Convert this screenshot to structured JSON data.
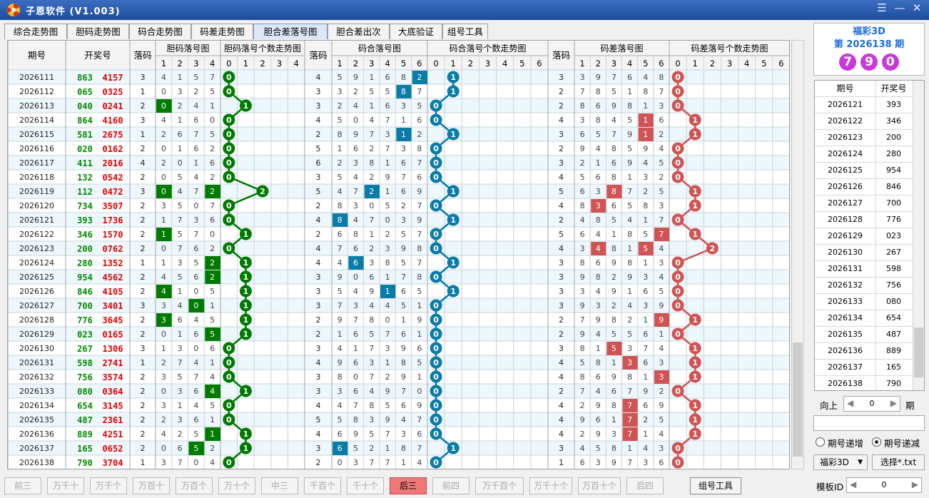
{
  "app": {
    "title": "子恩软件 (V1.003)",
    "minimize": "☰",
    "min": "—",
    "close": "✕"
  },
  "tabs": [
    "综合走势图",
    "胆码走势图",
    "码合走势图",
    "码差走势图",
    "胆合差落号图",
    "胆合差出次",
    "大底验证",
    "组号工具"
  ],
  "active_tab": 4,
  "grid": {
    "headers": {
      "period": "期号",
      "draw": "开奖号",
      "drop": "落码",
      "g1": "胆码落号图",
      "g2": "胆码落号个数走势图",
      "g3": "码合落号图",
      "g4": "码合落号个数走势图",
      "g5": "码差落号图",
      "g6": "码差落号个数走势图"
    },
    "sub_a": [
      "1",
      "2",
      "3",
      "4"
    ],
    "sub_b": [
      "0",
      "1",
      "2",
      "3",
      "4"
    ],
    "sub_c": [
      "1",
      "2",
      "3",
      "4",
      "5",
      "6"
    ],
    "sub_d": [
      "0",
      "1",
      "2",
      "3",
      "4",
      "5",
      "6"
    ],
    "colors": {
      "green": "#007a00",
      "blue": "#0a7ca8",
      "red": "#d05454",
      "row_alt": "#eef7fc",
      "green_text": "#008a00",
      "red_text": "#e00000"
    },
    "rows": [
      {
        "p": "2026111",
        "a": "863",
        "b": "4157",
        "d1": 3,
        "c1": [
          "4",
          "1",
          "5",
          "7"
        ],
        "h1": null,
        "n1": 0,
        "d2": 4,
        "c2": [
          "5",
          "9",
          "1",
          "6",
          "8",
          "2"
        ],
        "h2": 5,
        "n2": 1,
        "d3": 3,
        "c3": [
          "3",
          "9",
          "7",
          "6",
          "4",
          "8"
        ],
        "h3": null,
        "n3": 0
      },
      {
        "p": "2026112",
        "a": "065",
        "b": "0325",
        "d1": 1,
        "c1": [
          "0",
          "3",
          "2",
          "5"
        ],
        "h1": null,
        "n1": 0,
        "d2": 3,
        "c2": [
          "3",
          "2",
          "5",
          "5",
          "8",
          "7"
        ],
        "h2": 4,
        "n2": 1,
        "d3": 2,
        "c3": [
          "7",
          "8",
          "5",
          "1",
          "8",
          "7"
        ],
        "h3": null,
        "n3": 0
      },
      {
        "p": "2026113",
        "a": "040",
        "b": "0241",
        "d1": 2,
        "c1": [
          "0",
          "2",
          "4",
          "1"
        ],
        "h1": 0,
        "n1": 1,
        "d2": 3,
        "c2": [
          "2",
          "4",
          "1",
          "6",
          "3",
          "5"
        ],
        "h2": null,
        "n2": 0,
        "d3": 2,
        "c3": [
          "8",
          "6",
          "9",
          "8",
          "1",
          "3"
        ],
        "h3": null,
        "n3": 0
      },
      {
        "p": "2026114",
        "a": "864",
        "b": "4160",
        "d1": 3,
        "c1": [
          "4",
          "1",
          "6",
          "0"
        ],
        "h1": null,
        "n1": 0,
        "d2": 4,
        "c2": [
          "5",
          "0",
          "4",
          "7",
          "1",
          "6"
        ],
        "h2": null,
        "n2": 0,
        "d3": 4,
        "c3": [
          "3",
          "8",
          "4",
          "5",
          "1",
          "6"
        ],
        "h3": 4,
        "n3": 1
      },
      {
        "p": "2026115",
        "a": "581",
        "b": "2675",
        "d1": 1,
        "c1": [
          "2",
          "6",
          "7",
          "5"
        ],
        "h1": null,
        "n1": 0,
        "d2": 2,
        "c2": [
          "8",
          "9",
          "7",
          "3",
          "1",
          "2"
        ],
        "h2": 4,
        "n2": 1,
        "d3": 3,
        "c3": [
          "6",
          "5",
          "7",
          "9",
          "1",
          "2"
        ],
        "h3": 4,
        "n3": 1
      },
      {
        "p": "2026116",
        "a": "020",
        "b": "0162",
        "d1": 2,
        "c1": [
          "0",
          "1",
          "6",
          "2"
        ],
        "h1": null,
        "n1": 0,
        "d2": 5,
        "c2": [
          "1",
          "6",
          "2",
          "7",
          "3",
          "8"
        ],
        "h2": null,
        "n2": 0,
        "d3": 2,
        "c3": [
          "9",
          "4",
          "8",
          "5",
          "9",
          "4"
        ],
        "h3": null,
        "n3": 0
      },
      {
        "p": "2026117",
        "a": "411",
        "b": "2016",
        "d1": 4,
        "c1": [
          "2",
          "0",
          "1",
          "6"
        ],
        "h1": null,
        "n1": 0,
        "d2": 6,
        "c2": [
          "2",
          "3",
          "8",
          "1",
          "6",
          "7"
        ],
        "h2": null,
        "n2": 0,
        "d3": 3,
        "c3": [
          "2",
          "1",
          "6",
          "9",
          "4",
          "5"
        ],
        "h3": null,
        "n3": 0
      },
      {
        "p": "2026118",
        "a": "132",
        "b": "0542",
        "d1": 2,
        "c1": [
          "0",
          "5",
          "4",
          "2"
        ],
        "h1": null,
        "n1": 0,
        "d2": 3,
        "c2": [
          "5",
          "4",
          "2",
          "9",
          "7",
          "6"
        ],
        "h2": null,
        "n2": 0,
        "d3": 4,
        "c3": [
          "5",
          "6",
          "8",
          "1",
          "3",
          "2"
        ],
        "h3": null,
        "n3": 0
      },
      {
        "p": "2026119",
        "a": "112",
        "b": "0472",
        "d1": 3,
        "c1": [
          "0",
          "4",
          "7",
          "2"
        ],
        "h1": [
          0,
          3
        ],
        "n1": 2,
        "d2": 5,
        "c2": [
          "4",
          "7",
          "2",
          "1",
          "6",
          "9"
        ],
        "h2": 2,
        "n2": 1,
        "d3": 5,
        "c3": [
          "6",
          "3",
          "8",
          "7",
          "2",
          "5"
        ],
        "h3": 2,
        "n3": 1
      },
      {
        "p": "2026120",
        "a": "734",
        "b": "3507",
        "d1": 2,
        "c1": [
          "3",
          "5",
          "0",
          "7"
        ],
        "h1": null,
        "n1": 0,
        "d2": 2,
        "c2": [
          "8",
          "3",
          "0",
          "5",
          "2",
          "7"
        ],
        "h2": null,
        "n2": 0,
        "d3": 4,
        "c3": [
          "8",
          "3",
          "6",
          "5",
          "8",
          "3"
        ],
        "h3": 1,
        "n3": 1
      },
      {
        "p": "2026121",
        "a": "393",
        "b": "1736",
        "d1": 2,
        "c1": [
          "1",
          "7",
          "3",
          "6"
        ],
        "h1": null,
        "n1": 0,
        "d2": 4,
        "c2": [
          "8",
          "4",
          "7",
          "0",
          "3",
          "9"
        ],
        "h2": 0,
        "n2": 1,
        "d3": 2,
        "c3": [
          "4",
          "8",
          "5",
          "4",
          "1",
          "7"
        ],
        "h3": null,
        "n3": 0
      },
      {
        "p": "2026122",
        "a": "346",
        "b": "1570",
        "d1": 2,
        "c1": [
          "1",
          "5",
          "7",
          "0"
        ],
        "h1": 0,
        "n1": 1,
        "d2": 2,
        "c2": [
          "6",
          "8",
          "1",
          "2",
          "5",
          "7"
        ],
        "h2": null,
        "n2": 0,
        "d3": 5,
        "c3": [
          "6",
          "4",
          "1",
          "8",
          "5",
          "7"
        ],
        "h3": 5,
        "n3": 1
      },
      {
        "p": "2026123",
        "a": "200",
        "b": "0762",
        "d1": 2,
        "c1": [
          "0",
          "7",
          "6",
          "2"
        ],
        "h1": null,
        "n1": 0,
        "d2": 4,
        "c2": [
          "7",
          "6",
          "2",
          "3",
          "9",
          "8"
        ],
        "h2": null,
        "n2": 0,
        "d3": 4,
        "c3": [
          "3",
          "4",
          "8",
          "1",
          "5",
          "4"
        ],
        "h3": [
          1,
          4
        ],
        "n3": 2
      },
      {
        "p": "2026124",
        "a": "280",
        "b": "1352",
        "d1": 1,
        "c1": [
          "1",
          "3",
          "5",
          "2"
        ],
        "h1": 3,
        "n1": 1,
        "d2": 4,
        "c2": [
          "4",
          "6",
          "3",
          "8",
          "5",
          "7"
        ],
        "h2": 1,
        "n2": 1,
        "d3": 3,
        "c3": [
          "8",
          "6",
          "9",
          "8",
          "1",
          "3"
        ],
        "h3": null,
        "n3": 0
      },
      {
        "p": "2026125",
        "a": "954",
        "b": "4562",
        "d1": 2,
        "c1": [
          "4",
          "5",
          "6",
          "2"
        ],
        "h1": 3,
        "n1": 1,
        "d2": 3,
        "c2": [
          "9",
          "0",
          "6",
          "1",
          "7",
          "8"
        ],
        "h2": null,
        "n2": 0,
        "d3": 3,
        "c3": [
          "9",
          "8",
          "2",
          "9",
          "3",
          "4"
        ],
        "h3": null,
        "n3": 0
      },
      {
        "p": "2026126",
        "a": "846",
        "b": "4105",
        "d1": 2,
        "c1": [
          "4",
          "1",
          "0",
          "5"
        ],
        "h1": 0,
        "n1": 1,
        "d2": 3,
        "c2": [
          "5",
          "4",
          "9",
          "1",
          "6",
          "5"
        ],
        "h2": 3,
        "n2": 1,
        "d3": 3,
        "c3": [
          "3",
          "4",
          "9",
          "1",
          "6",
          "5"
        ],
        "h3": null,
        "n3": 0
      },
      {
        "p": "2026127",
        "a": "700",
        "b": "3401",
        "d1": 3,
        "c1": [
          "3",
          "4",
          "0",
          "1"
        ],
        "h1": 2,
        "n1": 1,
        "d2": 3,
        "c2": [
          "7",
          "3",
          "4",
          "4",
          "5",
          "1"
        ],
        "h2": null,
        "n2": 0,
        "d3": 3,
        "c3": [
          "9",
          "3",
          "2",
          "4",
          "3",
          "9"
        ],
        "h3": null,
        "n3": 0
      },
      {
        "p": "2026128",
        "a": "776",
        "b": "3645",
        "d1": 2,
        "c1": [
          "3",
          "6",
          "4",
          "5"
        ],
        "h1": 0,
        "n1": 1,
        "d2": 2,
        "c2": [
          "9",
          "7",
          "8",
          "0",
          "1",
          "9"
        ],
        "h2": null,
        "n2": 0,
        "d3": 2,
        "c3": [
          "7",
          "9",
          "8",
          "2",
          "1",
          "9"
        ],
        "h3": 5,
        "n3": 1
      },
      {
        "p": "2026129",
        "a": "023",
        "b": "0165",
        "d1": 2,
        "c1": [
          "0",
          "1",
          "6",
          "5"
        ],
        "h1": 3,
        "n1": 1,
        "d2": 2,
        "c2": [
          "1",
          "6",
          "5",
          "7",
          "6",
          "1"
        ],
        "h2": null,
        "n2": 0,
        "d3": 2,
        "c3": [
          "9",
          "4",
          "5",
          "5",
          "6",
          "1"
        ],
        "h3": null,
        "n3": 0
      },
      {
        "p": "2026130",
        "a": "267",
        "b": "1306",
        "d1": 3,
        "c1": [
          "1",
          "3",
          "0",
          "6"
        ],
        "h1": null,
        "n1": 0,
        "d2": 3,
        "c2": [
          "4",
          "1",
          "7",
          "3",
          "9",
          "6"
        ],
        "h2": null,
        "n2": 0,
        "d3": 3,
        "c3": [
          "8",
          "1",
          "5",
          "3",
          "7",
          "4"
        ],
        "h3": 2,
        "n3": 1
      },
      {
        "p": "2026131",
        "a": "598",
        "b": "2741",
        "d1": 1,
        "c1": [
          "2",
          "7",
          "4",
          "1"
        ],
        "h1": null,
        "n1": 0,
        "d2": 4,
        "c2": [
          "9",
          "6",
          "3",
          "1",
          "8",
          "5"
        ],
        "h2": null,
        "n2": 0,
        "d3": 4,
        "c3": [
          "5",
          "8",
          "1",
          "3",
          "6",
          "3"
        ],
        "h3": 3,
        "n3": 1
      },
      {
        "p": "2026132",
        "a": "756",
        "b": "3574",
        "d1": 2,
        "c1": [
          "3",
          "5",
          "7",
          "4"
        ],
        "h1": null,
        "n1": 0,
        "d2": 3,
        "c2": [
          "8",
          "0",
          "7",
          "2",
          "9",
          "1"
        ],
        "h2": null,
        "n2": 0,
        "d3": 4,
        "c3": [
          "8",
          "6",
          "9",
          "8",
          "1",
          "3"
        ],
        "h3": 5,
        "n3": 1
      },
      {
        "p": "2026133",
        "a": "080",
        "b": "0364",
        "d1": 2,
        "c1": [
          "0",
          "3",
          "6",
          "4"
        ],
        "h1": 3,
        "n1": 1,
        "d2": 3,
        "c2": [
          "3",
          "6",
          "4",
          "9",
          "7",
          "0"
        ],
        "h2": null,
        "n2": 0,
        "d3": 2,
        "c3": [
          "7",
          "4",
          "6",
          "7",
          "9",
          "2"
        ],
        "h3": null,
        "n3": 0
      },
      {
        "p": "2026134",
        "a": "654",
        "b": "3145",
        "d1": 2,
        "c1": [
          "3",
          "1",
          "4",
          "5"
        ],
        "h1": null,
        "n1": 0,
        "d2": 4,
        "c2": [
          "4",
          "7",
          "8",
          "5",
          "6",
          "9"
        ],
        "h2": null,
        "n2": 0,
        "d3": 4,
        "c3": [
          "2",
          "9",
          "8",
          "7",
          "6",
          "9"
        ],
        "h3": 3,
        "n3": 1
      },
      {
        "p": "2026135",
        "a": "487",
        "b": "2361",
        "d1": 2,
        "c1": [
          "2",
          "3",
          "6",
          "1"
        ],
        "h1": null,
        "n1": 0,
        "d2": 5,
        "c2": [
          "5",
          "8",
          "3",
          "9",
          "4",
          "7"
        ],
        "h2": null,
        "n2": 0,
        "d3": 4,
        "c3": [
          "9",
          "6",
          "1",
          "7",
          "2",
          "5"
        ],
        "h3": 3,
        "n3": 1
      },
      {
        "p": "2026136",
        "a": "889",
        "b": "4251",
        "d1": 2,
        "c1": [
          "4",
          "2",
          "5",
          "1"
        ],
        "h1": 3,
        "n1": 1,
        "d2": 4,
        "c2": [
          "6",
          "9",
          "5",
          "7",
          "3",
          "6"
        ],
        "h2": null,
        "n2": 0,
        "d3": 4,
        "c3": [
          "2",
          "9",
          "3",
          "7",
          "1",
          "4"
        ],
        "h3": 3,
        "n3": 1
      },
      {
        "p": "2026137",
        "a": "165",
        "b": "0652",
        "d1": 2,
        "c1": [
          "0",
          "6",
          "5",
          "2"
        ],
        "h1": 2,
        "n1": 1,
        "d2": 3,
        "c2": [
          "6",
          "5",
          "2",
          "1",
          "8",
          "7"
        ],
        "h2": 0,
        "n2": 1,
        "d3": 3,
        "c3": [
          "4",
          "5",
          "8",
          "1",
          "4",
          "3"
        ],
        "h3": null,
        "n3": 0
      },
      {
        "p": "2026138",
        "a": "790",
        "b": "3704",
        "d1": 1,
        "c1": [
          "3",
          "7",
          "0",
          "4"
        ],
        "h1": null,
        "n1": 0,
        "d2": 2,
        "c2": [
          "0",
          "3",
          "7",
          "7",
          "1",
          "4"
        ],
        "h2": null,
        "n2": 0,
        "d3": 1,
        "c3": [
          "6",
          "3",
          "9",
          "7",
          "3",
          "6"
        ],
        "h3": null,
        "n3": 0
      }
    ]
  },
  "info": {
    "line1": "福彩3D",
    "line2": "第 2026138 期",
    "balls": [
      "7",
      "9",
      "0"
    ],
    "ball_color": "#c83ad8"
  },
  "history": {
    "headers": [
      "期号",
      "开奖号"
    ],
    "rows": [
      [
        "2026121",
        "393"
      ],
      [
        "2026122",
        "346"
      ],
      [
        "2026123",
        "200"
      ],
      [
        "2026124",
        "280"
      ],
      [
        "2026125",
        "954"
      ],
      [
        "2026126",
        "846"
      ],
      [
        "2026127",
        "700"
      ],
      [
        "2026128",
        "776"
      ],
      [
        "2026129",
        "023"
      ],
      [
        "2026130",
        "267"
      ],
      [
        "2026131",
        "598"
      ],
      [
        "2026132",
        "756"
      ],
      [
        "2026133",
        "080"
      ],
      [
        "2026134",
        "654"
      ],
      [
        "2026135",
        "487"
      ],
      [
        "2026136",
        "889"
      ],
      [
        "2026137",
        "165"
      ],
      [
        "2026138",
        "790"
      ]
    ]
  },
  "controls": {
    "up_label": "向上",
    "up_value": "0",
    "period_label": "期",
    "radio_inc": "期号递增",
    "radio_dec": "期号递减",
    "radio_selected": "dec",
    "lottery": "福彩3D",
    "select_file": "选择*.txt",
    "template_label": "模板ID",
    "template_value": "0"
  },
  "bottom_buttons": [
    "前三",
    "万千十",
    "万千个",
    "万百十",
    "万百个",
    "万十个",
    "中三",
    "千百个",
    "千十个",
    "后三",
    "前四",
    "万千百个",
    "万千十个",
    "万百十个",
    "后四"
  ],
  "active_bottom": "后三",
  "tool_button": "组号工具"
}
